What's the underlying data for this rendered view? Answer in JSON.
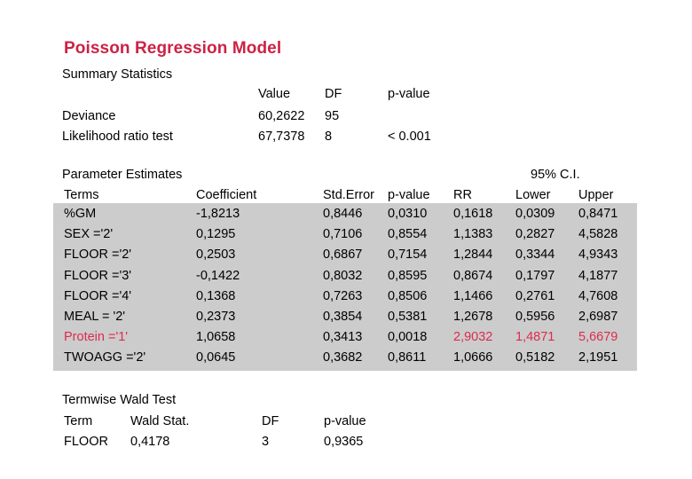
{
  "title": "Poisson Regression Model",
  "colors": {
    "title_red": "#cc2244",
    "highlight_red": "#dd2b4e",
    "band_gray": "#cccccc",
    "background": "#ffffff"
  },
  "summary": {
    "caption": "Summary Statistics",
    "headers": {
      "label": "",
      "value": "Value",
      "df": "DF",
      "pvalue": "p-value"
    },
    "rows": [
      {
        "label": "Deviance",
        "value": "60,2622",
        "df": "95",
        "pvalue": ""
      },
      {
        "label": "Likelihood ratio test",
        "value": "67,7378",
        "df": "8",
        "pvalue": "< 0.001"
      }
    ]
  },
  "estimates": {
    "caption": "Parameter Estimates",
    "ci_caption": "95% C.I.",
    "headers": {
      "terms": "Terms",
      "coefficient": "Coefficient",
      "std_error": "Std.Error",
      "pvalue": "p-value",
      "rr": "RR",
      "lower": "Lower",
      "upper": "Upper"
    },
    "rows": [
      {
        "term": "%GM",
        "coefficient": "-1,8213",
        "std_error": "0,8446",
        "pvalue": "0,0310",
        "rr": "0,1618",
        "lower": "0,0309",
        "upper": "0,8471",
        "highlight": false
      },
      {
        "term": "SEX ='2'",
        "coefficient": "0,1295",
        "std_error": "0,7106",
        "pvalue": "0,8554",
        "rr": "1,1383",
        "lower": "0,2827",
        "upper": "4,5828",
        "highlight": false
      },
      {
        "term": "FLOOR ='2'",
        "coefficient": "0,2503",
        "std_error": "0,6867",
        "pvalue": "0,7154",
        "rr": "1,2844",
        "lower": "0,3344",
        "upper": "4,9343",
        "highlight": false
      },
      {
        "term": "FLOOR ='3'",
        "coefficient": "-0,1422",
        "std_error": "0,8032",
        "pvalue": "0,8595",
        "rr": "0,8674",
        "lower": "0,1797",
        "upper": "4,1877",
        "highlight": false
      },
      {
        "term": "FLOOR ='4'",
        "coefficient": "0,1368",
        "std_error": "0,7263",
        "pvalue": "0,8506",
        "rr": "1,1466",
        "lower": "0,2761",
        "upper": "4,7608",
        "highlight": false
      },
      {
        "term": "MEAL = '2'",
        "coefficient": "0,2373",
        "std_error": "0,3854",
        "pvalue": "0,5381",
        "rr": "1,2678",
        "lower": "0,5956",
        "upper": "2,6987",
        "highlight": false
      },
      {
        "term": "Protein ='1'",
        "coefficient": "1,0658",
        "std_error": "0,3413",
        "pvalue": "0,0018",
        "rr": "2,9032",
        "lower": "1,4871",
        "upper": "5,6679",
        "highlight": true
      },
      {
        "term": "TWOAGG ='2'",
        "coefficient": "0,0645",
        "std_error": "0,3682",
        "pvalue": "0,8611",
        "rr": "1,0666",
        "lower": "0,5182",
        "upper": "2,1951",
        "highlight": false
      }
    ]
  },
  "wald": {
    "caption": "Termwise Wald Test",
    "headers": {
      "term": "Term",
      "stat": "Wald Stat.",
      "df": "DF",
      "pvalue": "p-value"
    },
    "rows": [
      {
        "term": "FLOOR",
        "stat": "0,4178",
        "df": "3",
        "pvalue": "0,9365"
      }
    ]
  }
}
